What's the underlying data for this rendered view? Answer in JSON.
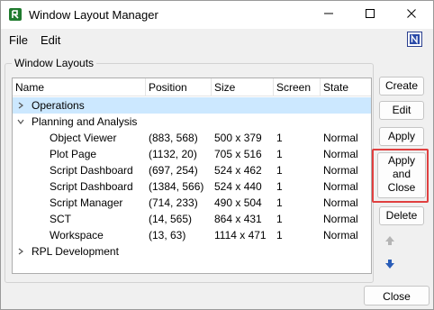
{
  "window": {
    "title": "Window Layout Manager"
  },
  "menu": {
    "file": "File",
    "edit": "Edit"
  },
  "group": {
    "label": "Window Layouts"
  },
  "columns": [
    "Name",
    "Position",
    "Size",
    "Screen",
    "State"
  ],
  "rows": [
    {
      "name": "Operations",
      "position": "",
      "size": "",
      "screen": "",
      "state": ""
    },
    {
      "name": "Planning and Analysis",
      "position": "",
      "size": "",
      "screen": "",
      "state": ""
    },
    {
      "name": "Object Viewer",
      "position": "(883, 568)",
      "size": "500 x 379",
      "screen": "1",
      "state": "Normal"
    },
    {
      "name": "Plot Page",
      "position": "(1132, 20)",
      "size": "705 x 516",
      "screen": "1",
      "state": "Normal"
    },
    {
      "name": "Script Dashboard",
      "position": "(697, 254)",
      "size": "524 x 462",
      "screen": "1",
      "state": "Normal"
    },
    {
      "name": "Script Dashboard",
      "position": "(1384, 566)",
      "size": "524 x 440",
      "screen": "1",
      "state": "Normal"
    },
    {
      "name": "Script Manager",
      "position": "(714, 233)",
      "size": "490 x 504",
      "screen": "1",
      "state": "Normal"
    },
    {
      "name": "SCT",
      "position": "(14, 565)",
      "size": "864 x 431",
      "screen": "1",
      "state": "Normal"
    },
    {
      "name": "Workspace",
      "position": "(13, 63)",
      "size": "1114 x 471",
      "screen": "1",
      "state": "Normal"
    },
    {
      "name": "RPL Development",
      "position": "",
      "size": "",
      "screen": "",
      "state": ""
    }
  ],
  "buttons": {
    "create": "Create",
    "edit": "Edit",
    "apply": "Apply",
    "apply_close_1": "Apply",
    "apply_close_2": "and",
    "apply_close_3": "Close",
    "delete": "Delete",
    "close": "Close"
  },
  "icons": {
    "app": "window-layout-app-icon",
    "menu_right": "nav-badge-icon",
    "move_up": "arrow-up-icon",
    "move_down": "arrow-down-icon"
  },
  "colors": {
    "selection": "#cce8ff",
    "highlight_border": "#e04040",
    "app_icon_green": "#1f7a2e",
    "move_down_blue": "#2a5db8"
  }
}
